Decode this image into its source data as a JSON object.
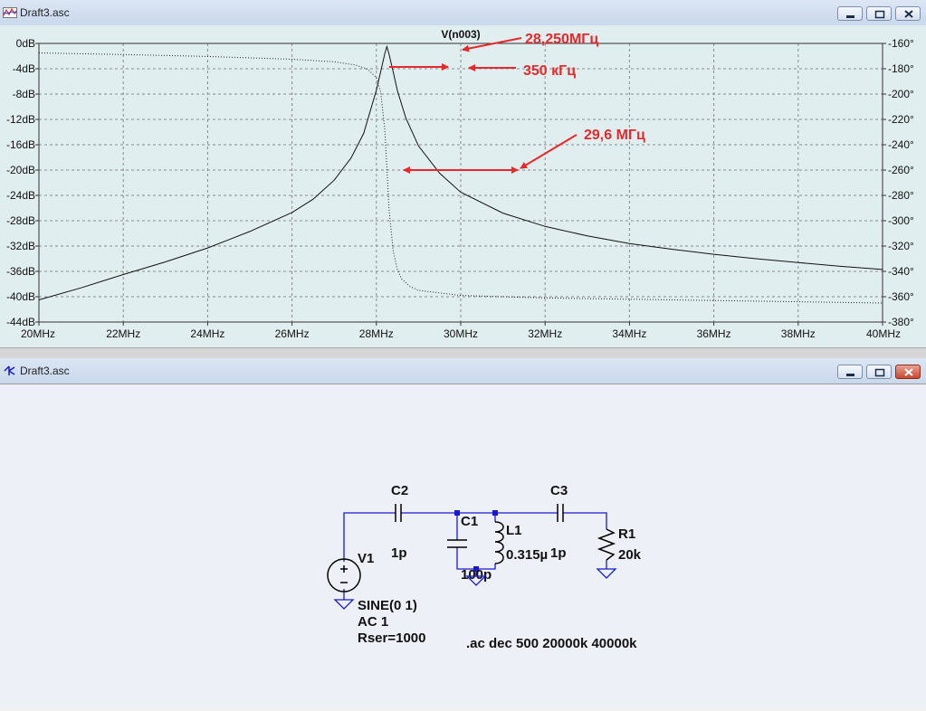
{
  "plot_window": {
    "title": "Draft3.asc"
  },
  "schematic_window": {
    "title": "Draft3.asc"
  },
  "chart_data": {
    "type": "line",
    "title": "V(n003)",
    "x_unit": "MHz",
    "xlim": [
      20,
      40
    ],
    "x_ticks": [
      20,
      22,
      24,
      26,
      28,
      30,
      32,
      34,
      36,
      38,
      40
    ],
    "x_tick_labels": [
      "20MHz",
      "22MHz",
      "24MHz",
      "26MHz",
      "28MHz",
      "30MHz",
      "32MHz",
      "34MHz",
      "36MHz",
      "38MHz",
      "40MHz"
    ],
    "ylim_left": [
      -44,
      0
    ],
    "y_left_ticks": [
      0,
      -4,
      -8,
      -12,
      -16,
      -20,
      -24,
      -28,
      -32,
      -36,
      -40,
      -44
    ],
    "y_left_tick_labels": [
      "0dB",
      "-4dB",
      "-8dB",
      "-12dB",
      "-16dB",
      "-20dB",
      "-24dB",
      "-28dB",
      "-32dB",
      "-36dB",
      "-40dB",
      "-44dB"
    ],
    "ylim_right": [
      -380,
      -160
    ],
    "y_right_ticks": [
      -160,
      -180,
      -200,
      -220,
      -240,
      -260,
      -280,
      -300,
      -320,
      -340,
      -360,
      -380
    ],
    "y_right_tick_labels": [
      "-160°",
      "-180°",
      "-200°",
      "-220°",
      "-240°",
      "-260°",
      "-280°",
      "-300°",
      "-320°",
      "-340°",
      "-360°",
      "-380°"
    ],
    "grid": true,
    "series": [
      {
        "kind": "magnitude_dB",
        "x": [
          20,
          21,
          22,
          23,
          24,
          25,
          26,
          26.5,
          27,
          27.4,
          27.7,
          28,
          28.1,
          28.2,
          28.25,
          28.3,
          28.4,
          28.5,
          28.7,
          29,
          29.5,
          30,
          31,
          32,
          33,
          34,
          35,
          36,
          37,
          38,
          39,
          40
        ],
        "values": [
          -40.5,
          -38.6,
          -36.5,
          -34.5,
          -32.3,
          -29.7,
          -26.7,
          -24.6,
          -21.6,
          -18.1,
          -14.2,
          -7.4,
          -4.5,
          -1.6,
          -0.5,
          -1.7,
          -4.5,
          -7.5,
          -11.8,
          -16.2,
          -20.5,
          -23.5,
          -26.8,
          -28.9,
          -30.4,
          -31.6,
          -32.5,
          -33.3,
          -34.0,
          -34.6,
          -35.2,
          -35.7
        ]
      },
      {
        "kind": "phase_deg",
        "x": [
          20,
          22,
          24,
          26,
          27,
          27.5,
          27.8,
          28,
          28.1,
          28.2,
          28.25,
          28.3,
          28.4,
          28.5,
          28.6,
          28.8,
          29,
          30,
          32,
          34,
          36,
          38,
          40
        ],
        "values": [
          -167.5,
          -168.8,
          -170.3,
          -172.5,
          -174.5,
          -177,
          -180.5,
          -187,
          -198,
          -228,
          -258,
          -291,
          -324,
          -339,
          -346,
          -352,
          -355,
          -359,
          -361,
          -362,
          -363,
          -364,
          -365
        ]
      }
    ],
    "annotations": [
      {
        "text": "28,250МГц",
        "color": "#e8292b"
      },
      {
        "text": "350 кГц",
        "color": "#e8292b"
      },
      {
        "text": "29,6 МГц",
        "color": "#e8292b"
      }
    ]
  },
  "schematic": {
    "wire_color": "#1a1acc",
    "components": [
      {
        "ref": "C2",
        "value": "1p"
      },
      {
        "ref": "C3",
        "value": "1p"
      },
      {
        "ref": "C1",
        "value": "100p"
      },
      {
        "ref": "L1",
        "value": "0.315µ"
      },
      {
        "ref": "R1",
        "value": "20k"
      },
      {
        "ref": "V1",
        "params": [
          "SINE(0 1)",
          "AC 1",
          "Rser=1000"
        ]
      }
    ],
    "directive": ".ac dec 500 20000k 40000k"
  }
}
